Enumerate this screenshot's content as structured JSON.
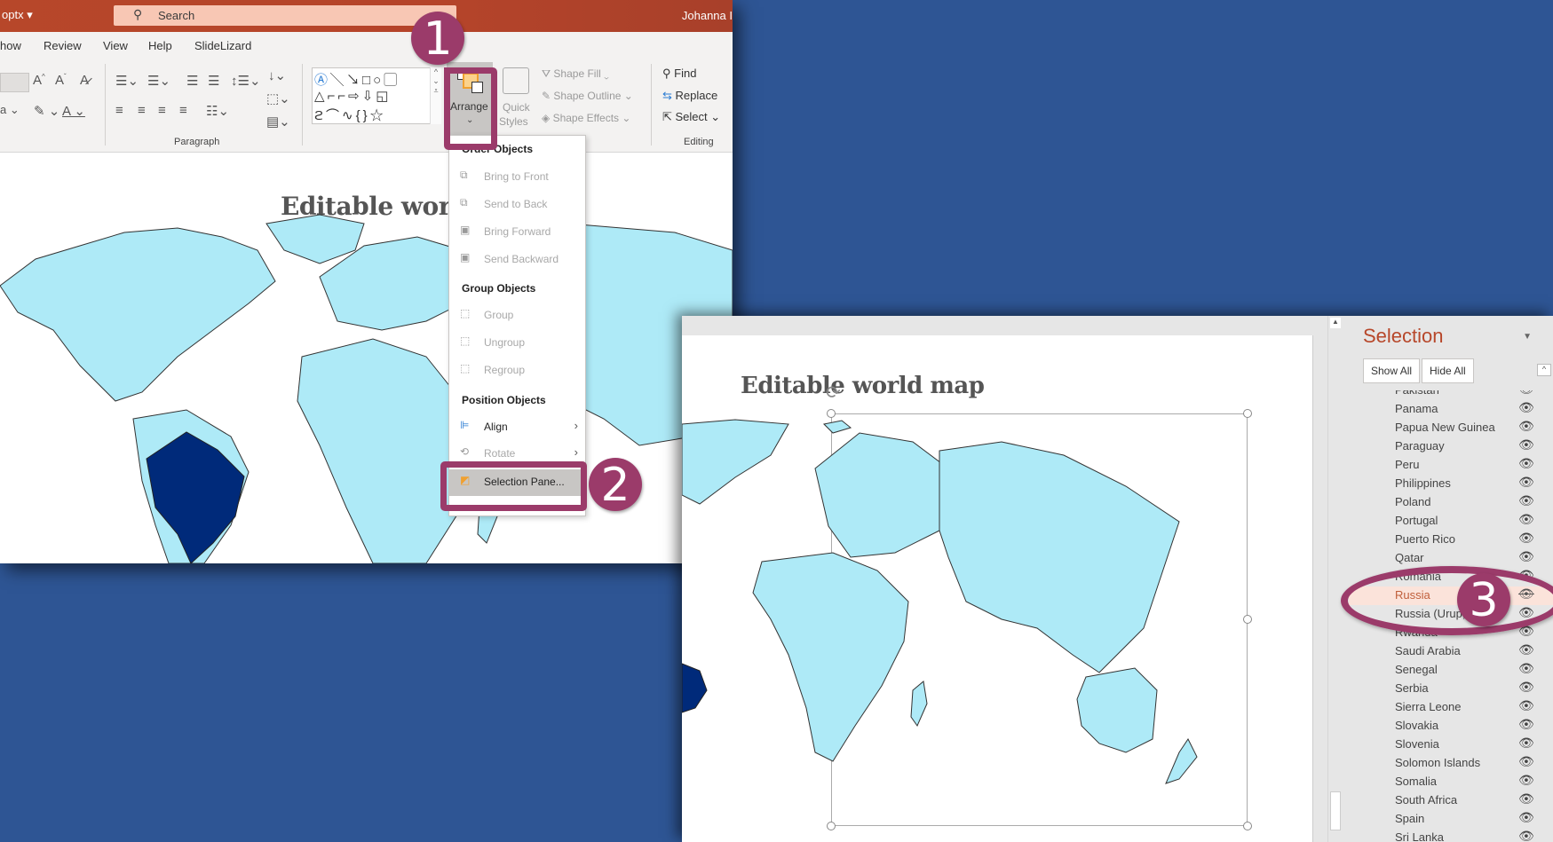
{
  "window1": {
    "file_name": "optx",
    "search_placeholder": "Search",
    "user": "Johanna I",
    "tabs": [
      "how",
      "Review",
      "View",
      "Help",
      "SlideLizard"
    ],
    "groups": {
      "paragraph": "Paragraph",
      "editing": "Editing"
    },
    "arrange": {
      "label": "Arrange",
      "chevron": "⌄"
    },
    "quick_styles": {
      "line1": "Quick",
      "line2": "Styles"
    },
    "shape_format": {
      "fill": "Shape Fill",
      "outline": "Shape Outline",
      "effects": "Shape Effects"
    },
    "editing": {
      "find": "Find",
      "replace": "Replace",
      "select": "Select"
    },
    "slide_title": "Editable world"
  },
  "arrange_menu": {
    "order_header": "Order Objects",
    "order_items": [
      "Bring to Front",
      "Send to Back",
      "Bring Forward",
      "Send Backward"
    ],
    "group_header": "Group Objects",
    "group_items": [
      "Group",
      "Ungroup",
      "Regroup"
    ],
    "position_header": "Position Objects",
    "align": "Align",
    "rotate": "Rotate",
    "selection_pane": "Selection Pane..."
  },
  "window2": {
    "slide_title": "Editable world map"
  },
  "selection_pane": {
    "title": "Selection",
    "show_all": "Show All",
    "hide_all": "Hide All",
    "items": [
      {
        "name": "Pakistan",
        "visible": true
      },
      {
        "name": "Panama",
        "visible": true
      },
      {
        "name": "Papua New Guinea",
        "visible": true
      },
      {
        "name": "Paraguay",
        "visible": true
      },
      {
        "name": "Peru",
        "visible": true
      },
      {
        "name": "Philippines",
        "visible": true
      },
      {
        "name": "Poland",
        "visible": true
      },
      {
        "name": "Portugal",
        "visible": true
      },
      {
        "name": "Puerto Rico",
        "visible": true
      },
      {
        "name": "Qatar",
        "visible": true
      },
      {
        "name": "Romania",
        "visible": true
      },
      {
        "name": "Russia",
        "visible": false
      },
      {
        "name": "Russia (Urup,Sim...",
        "visible": true
      },
      {
        "name": "Rwanda",
        "visible": true
      },
      {
        "name": "Saudi Arabia",
        "visible": true
      },
      {
        "name": "Senegal",
        "visible": true
      },
      {
        "name": "Serbia",
        "visible": true
      },
      {
        "name": "Sierra Leone",
        "visible": true
      },
      {
        "name": "Slovakia",
        "visible": true
      },
      {
        "name": "Slovenia",
        "visible": true
      },
      {
        "name": "Solomon Islands",
        "visible": true
      },
      {
        "name": "Somalia",
        "visible": true
      },
      {
        "name": "South Africa",
        "visible": true
      },
      {
        "name": "Spain",
        "visible": true
      },
      {
        "name": "Sri Lanka",
        "visible": true
      }
    ]
  },
  "annotations": {
    "step1": "1",
    "step2": "2",
    "step3": "3"
  },
  "colors": {
    "accent": "#b7472a",
    "annotation": "#9b3b6a",
    "map_land": "#aeeaf7",
    "brazil_highlight": "#002a7a",
    "background": "#2e5594"
  },
  "icons": {
    "eye": "👁",
    "search": "⚲"
  }
}
